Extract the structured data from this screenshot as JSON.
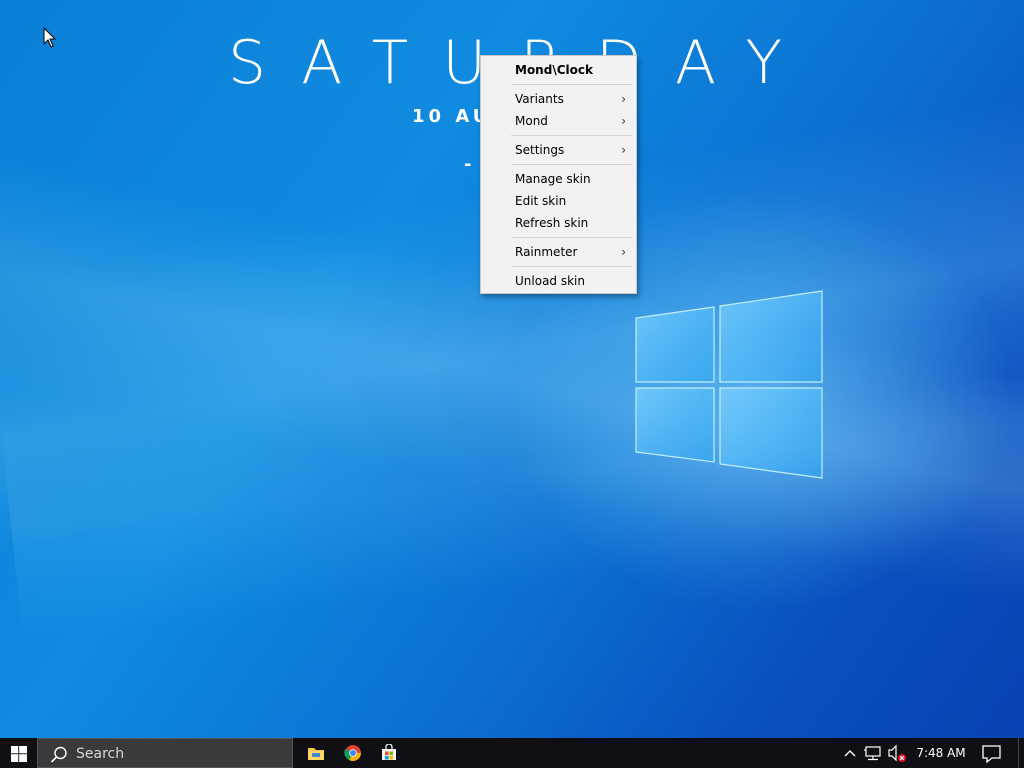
{
  "desktop": {
    "wallpaper": "windows-10-hero-blue",
    "accent_color": "#0b7fd6"
  },
  "clock_skin": {
    "day": "SATURDAY",
    "date": "10 AUG",
    "time": "- 0"
  },
  "context_menu": {
    "title": "Mond\\Clock",
    "items": [
      {
        "label": "Variants",
        "submenu": true
      },
      {
        "label": "Mond",
        "submenu": true
      },
      {
        "label": "Settings",
        "submenu": true
      },
      {
        "label": "Manage skin",
        "submenu": false
      },
      {
        "label": "Edit skin",
        "submenu": false
      },
      {
        "label": "Refresh skin",
        "submenu": false
      },
      {
        "label": "Rainmeter",
        "submenu": true
      },
      {
        "label": "Unload skin",
        "submenu": false
      }
    ],
    "submenu_arrow": ">"
  },
  "taskbar": {
    "start_icon": "windows-logo-icon",
    "search": {
      "placeholder": "Search",
      "icon": "search-icon"
    },
    "pinned_apps": [
      {
        "name": "File Explorer",
        "icon": "folder-icon"
      },
      {
        "name": "Google Chrome",
        "icon": "chrome-icon"
      },
      {
        "name": "Microsoft Store",
        "icon": "store-icon"
      }
    ],
    "tray": {
      "chevron_icon": "chevron-up-icon",
      "network_icon": "network-icon",
      "volume_icon": "volume-muted-icon",
      "time": "7:48 AM",
      "notification_icon": "action-center-icon"
    }
  }
}
